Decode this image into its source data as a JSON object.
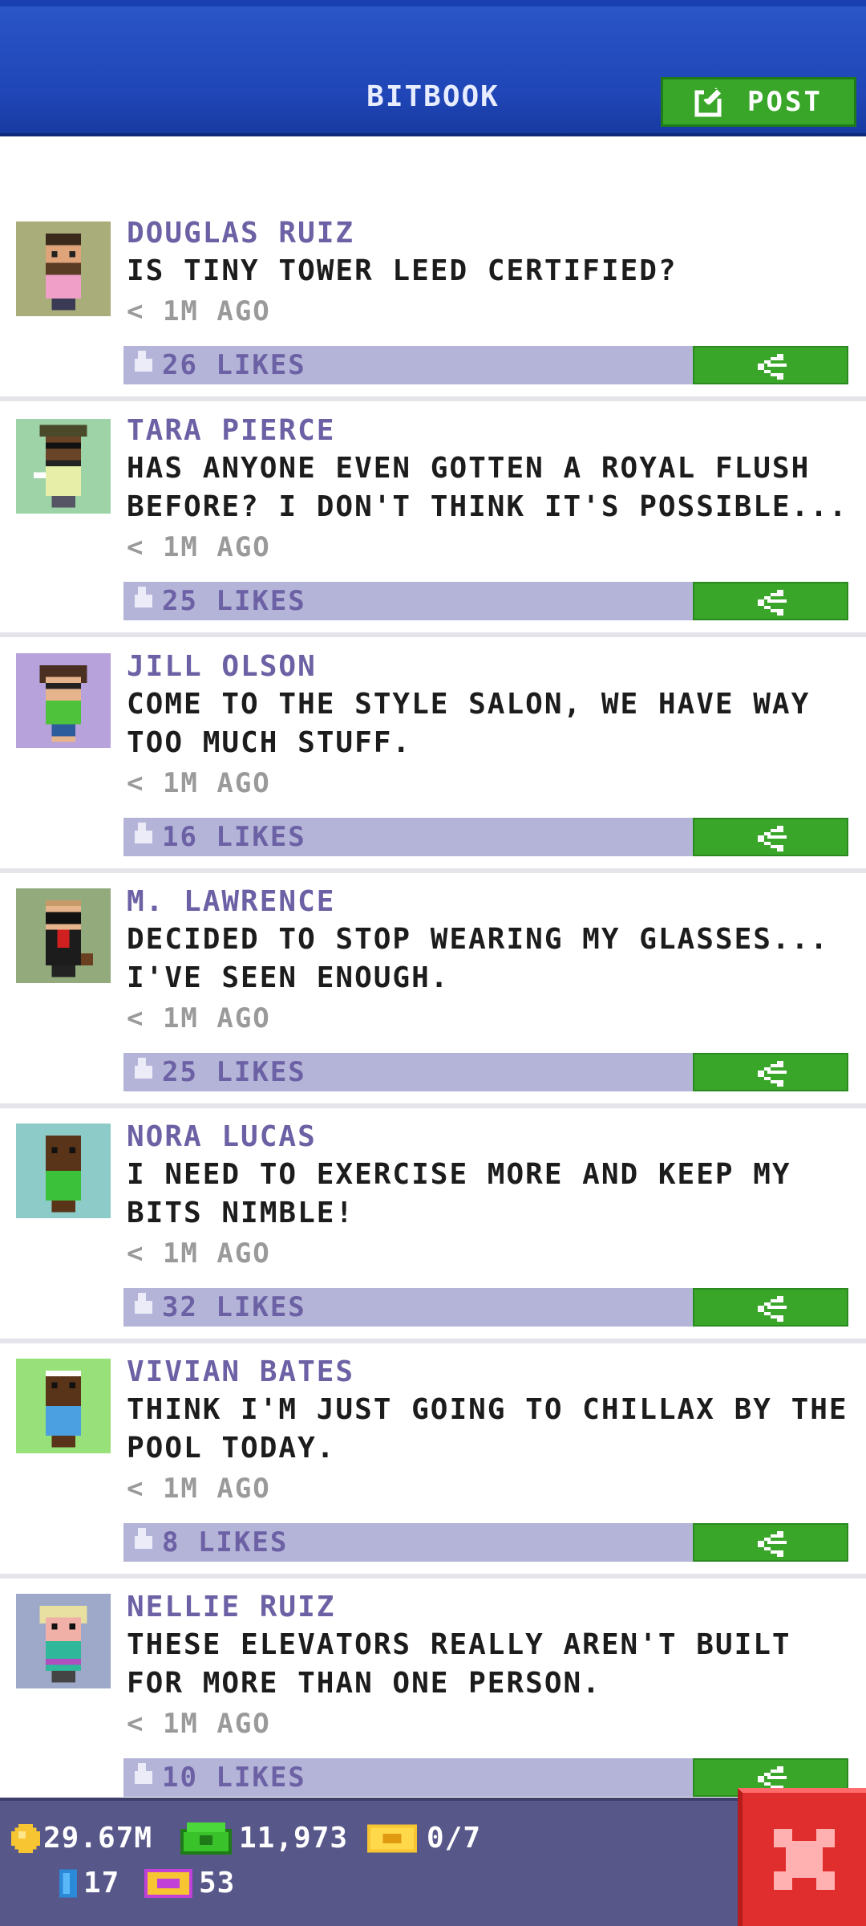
{
  "header": {
    "title": "BITBOOK",
    "post_label": "POST"
  },
  "posts": [
    {
      "name": "DOUGLAS RUIZ",
      "text": "IS TINY TOWER LEED CERTIFIED?",
      "time": "< 1M AGO",
      "likes": "26 LIKES",
      "avatar_bg": "#a9ad7a"
    },
    {
      "name": "TARA PIERCE",
      "text": "HAS ANYONE EVEN GOTTEN A ROYAL FLUSH BEFORE? I DON'T THINK IT'S POSSIBLE...",
      "time": "< 1M AGO",
      "likes": "25 LIKES",
      "avatar_bg": "#9ed3a8"
    },
    {
      "name": "JILL OLSON",
      "text": "COME TO THE STYLE SALON, WE HAVE WAY TOO MUCH STUFF.",
      "time": "< 1M AGO",
      "likes": "16 LIKES",
      "avatar_bg": "#b8a2dc"
    },
    {
      "name": "M. LAWRENCE",
      "text": "DECIDED TO STOP WEARING MY GLASSES... I'VE SEEN ENOUGH.",
      "time": "< 1M AGO",
      "likes": "25 LIKES",
      "avatar_bg": "#93aa7c"
    },
    {
      "name": "NORA LUCAS",
      "text": "I NEED TO EXERCISE MORE AND KEEP MY BITS NIMBLE!",
      "time": "< 1M AGO",
      "likes": "32 LIKES",
      "avatar_bg": "#8ccbc7"
    },
    {
      "name": "VIVIAN BATES",
      "text": "THINK I'M JUST GOING TO CHILLAX BY THE POOL TODAY.",
      "time": "< 1M AGO",
      "likes": "8 LIKES",
      "avatar_bg": "#97e07a"
    },
    {
      "name": "NELLIE RUIZ",
      "text": "THESE ELEVATORS REALLY AREN'T BUILT FOR MORE THAN ONE PERSON.",
      "time": "< 1M AGO",
      "likes": "10 LIKES",
      "avatar_bg": "#9ea8c8"
    }
  ],
  "status": {
    "coins": "29.67M",
    "bux": "11,973",
    "tickets": "0/7",
    "keys": "17",
    "vip": "53"
  },
  "colors": {
    "header_blue": "#1f45b6",
    "green": "#39a629",
    "likes_bar": "#b4b4d8",
    "name_purple": "#6b61a4",
    "close_red": "#e02d2d"
  }
}
